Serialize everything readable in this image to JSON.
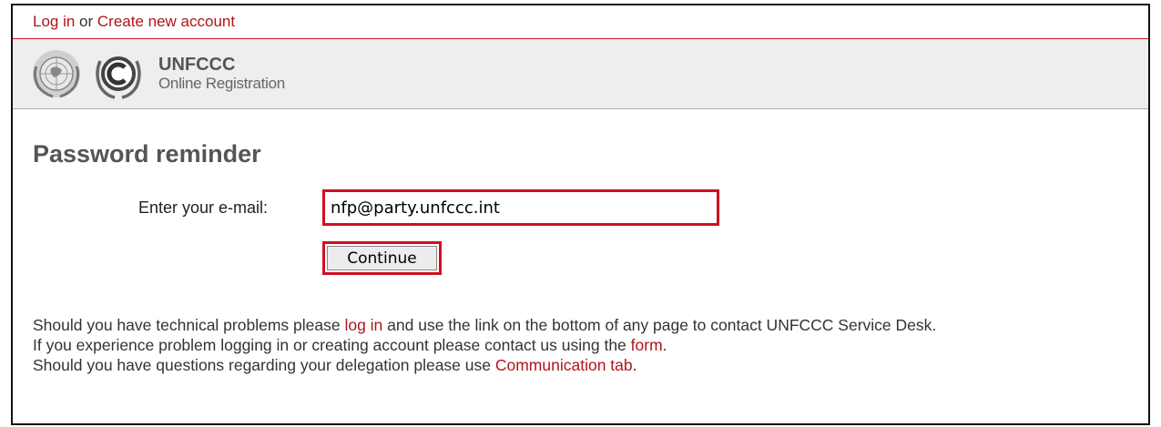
{
  "topbar": {
    "login_link": "Log in",
    "separator": " or ",
    "create_link": "Create new account"
  },
  "banner": {
    "logo_un": "un-emblem-icon",
    "logo_unfccc": "unfccc-c-logo-icon",
    "brand_name": "UNFCCC",
    "brand_sub": "Online Registration"
  },
  "form": {
    "title": "Password reminder",
    "email_label": "Enter your e-mail:",
    "email_value": "nfp@party.unfccc.int",
    "continue_label": "Continue"
  },
  "info": {
    "line1_pre": "Should you have technical problems please ",
    "line1_link": "log in",
    "line1_post": " and use the link on the bottom of any page to contact UNFCCC Service Desk.",
    "line2_pre": "If you experience problem logging in or creating account please contact us using the ",
    "line2_link": "form",
    "line2_post": ".",
    "line3_pre": "Should you have questions regarding your delegation please use ",
    "line3_link": "Communication tab",
    "line3_post": "."
  },
  "colors": {
    "link": "#b0141c",
    "highlight": "#d01020",
    "banner_bg": "#eeeeee"
  }
}
